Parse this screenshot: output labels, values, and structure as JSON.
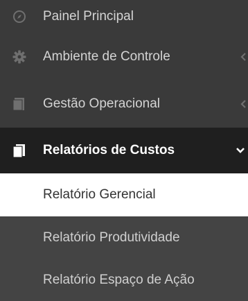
{
  "sidebar": {
    "items": [
      {
        "label": "Painel Principal",
        "icon": "compass-icon"
      },
      {
        "label": "Ambiente de Controle",
        "icon": "gear-icon",
        "chevron": "chevron-left-icon"
      },
      {
        "label": "Gestão Operacional",
        "icon": "folder-icon",
        "chevron": "chevron-left-icon"
      },
      {
        "label": "Relatórios de Custos",
        "icon": "documents-icon",
        "chevron": "chevron-down-icon",
        "active": true
      }
    ],
    "submenu": [
      {
        "label": "Relatório Gerencial",
        "selected": true
      },
      {
        "label": "Relatório Produtividade"
      },
      {
        "label": "Relatório Espaço de Ação"
      }
    ]
  },
  "colors": {
    "sidebar_bg": "#3a3a3a",
    "active_bg": "#1f1f1f",
    "submenu_bg": "#444444",
    "selected_bg": "#ffffff",
    "text": "#d4d4d4"
  }
}
